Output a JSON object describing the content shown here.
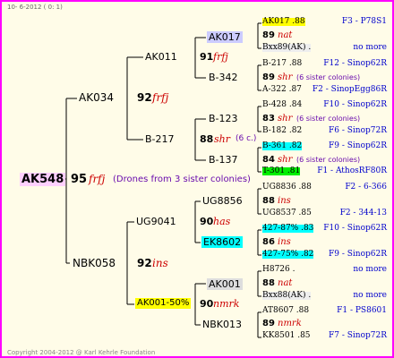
{
  "header": "10-  6-2012 (  0:  1)",
  "footer": "Copyright 2004-2012 @ Karl Kehrle Foundation",
  "highlight_colors": {
    "root": "#ffd0ff",
    "ak001_gen1": "#ccccff",
    "ak001_gen2": "#dddddd",
    "yellow": "#ffff00",
    "cyan": "#00ffff",
    "green": "#00ee00"
  },
  "root": {
    "name": "AK548",
    "num": "95",
    "breed": "frfj",
    "note": "(Drones from 3 sister colonies)"
  },
  "gen1": [
    {
      "name": "AK034",
      "num": "92",
      "breed": "frfj"
    },
    {
      "name": "NBK058",
      "num": "92",
      "breed": "ins"
    }
  ],
  "gen2": [
    {
      "name": "AK011",
      "num": "91",
      "breed": "frfj",
      "extra": ""
    },
    {
      "name": "B-217",
      "num": "88",
      "breed": "shr",
      "extra": "(6 c.)"
    },
    {
      "name": "UG9041",
      "num": "90",
      "breed": "has",
      "extra": ""
    },
    {
      "name": "AK001-50%",
      "num": "90",
      "breed": "nmrk",
      "extra": ""
    }
  ],
  "gen3": [
    {
      "name": "AK017"
    },
    {
      "name": "B-342"
    },
    {
      "name": "B-123"
    },
    {
      "name": "B-137"
    },
    {
      "name": "UG8856"
    },
    {
      "name": "EK8602"
    },
    {
      "name": "AK001"
    },
    {
      "name": "NBK013"
    }
  ],
  "gen4": [
    {
      "top": "AK017 .88",
      "top_right": "F3 - P78S1",
      "num": "89",
      "breed": "nat",
      "extra": "",
      "bot": "Bxx89(AK) .",
      "bot_right": "no more"
    },
    {
      "top": "B-217 .88",
      "top_right": "F12 - Sinop62R",
      "num": "89",
      "breed": "shr",
      "extra": "(6 sister colonies)",
      "bot": "A-322 .87",
      "bot_right": "F2 - SinopEgg86R"
    },
    {
      "top": "B-428 .84",
      "top_right": "F10 - Sinop62R",
      "num": "83",
      "breed": "shr",
      "extra": "(6 sister colonies)",
      "bot": "B-182 .82",
      "bot_right": "F6 - Sinop72R"
    },
    {
      "top": "B-361 .82",
      "top_right": "F9 - Sinop62R",
      "num": "84",
      "breed": "shr",
      "extra": "(6 sister colonies)",
      "bot": "T-301 .81",
      "bot_right": "F1 - AthosRF80R"
    },
    {
      "top": "UG8836 .88",
      "top_right": "F2 - 6-366",
      "num": "88",
      "breed": "ins",
      "extra": "",
      "bot": "UG8537 .85",
      "bot_right": "F2 - 344-13"
    },
    {
      "top": "427-87% .83",
      "top_right": "F10 - Sinop62R",
      "num": "86",
      "breed": "ins",
      "extra": "",
      "bot": "427-75% .82",
      "bot_right": "F9 - Sinop62R"
    },
    {
      "top": "H8726 .",
      "top_right": "no more",
      "num": "88",
      "breed": "nat",
      "extra": "",
      "bot": "Bxx88(AK) .",
      "bot_right": "no more"
    },
    {
      "top": "AT8607 .88",
      "top_right": "F1 - PS8601",
      "num": "89",
      "breed": "nmrk",
      "extra": "",
      "bot": "KK8501 .85",
      "bot_right": "F7 - Sinop72R"
    }
  ]
}
